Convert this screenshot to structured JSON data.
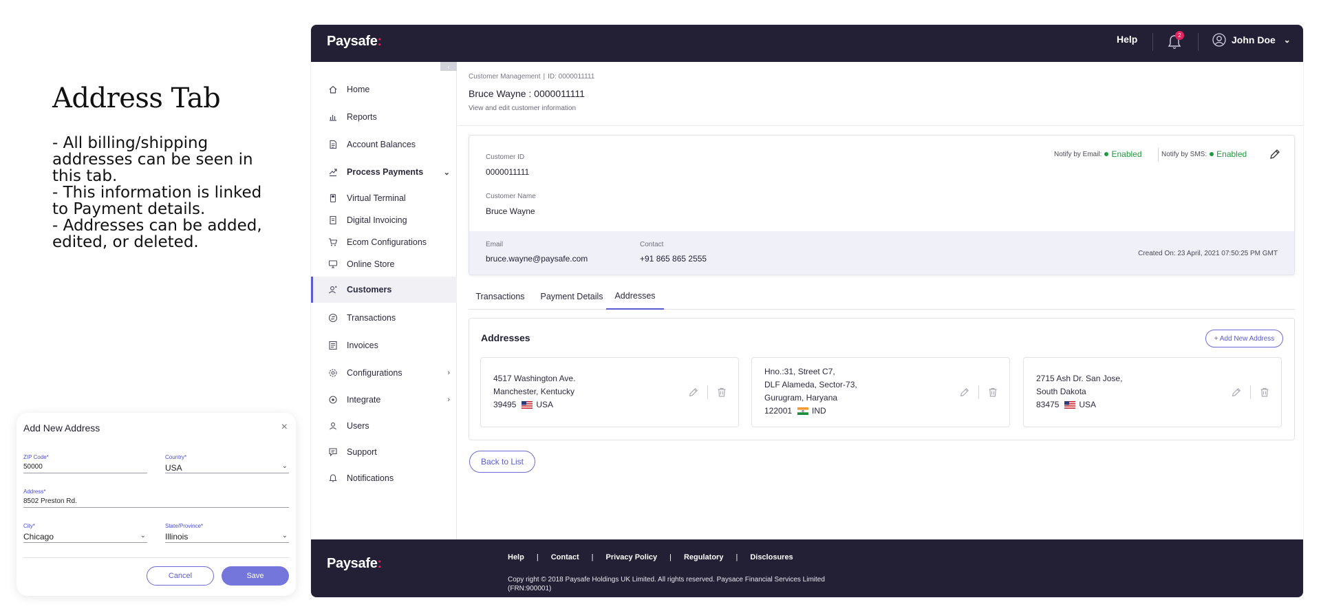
{
  "explainer": {
    "title": "Address Tab",
    "lines": [
      "- All billing/shipping addresses can be seen in this tab.",
      "- This information is linked to Payment details.",
      "- Addresses can be added, edited, or deleted."
    ]
  },
  "modal": {
    "title": "Add New Address",
    "close_icon": "×",
    "zip_label": "ZIP Code*",
    "zip_value": "50000",
    "country_label": "Country*",
    "country_value": "USA",
    "address_label": "Address*",
    "address_value": "8502 Preston Rd.",
    "city_label": "City*",
    "city_value": "Chicago",
    "state_label": "State/Province*",
    "state_value": "Illinois",
    "cancel_label": "Cancel",
    "save_label": "Save"
  },
  "topbar": {
    "brand": "Paysafe",
    "brand_dot": ":",
    "help_label": "Help",
    "notification_count": "2",
    "user_name": "John Doe"
  },
  "sidebar": {
    "items": [
      {
        "label": "Home",
        "icon": "home-icon"
      },
      {
        "label": "Reports",
        "icon": "reports-icon"
      },
      {
        "label": "Account Balances",
        "icon": "document-icon"
      },
      {
        "label": "Process Payments",
        "icon": "payments-icon"
      },
      {
        "label": "Virtual Terminal",
        "icon": "terminal-icon"
      },
      {
        "label": "Digital Invoicing",
        "icon": "invoice-icon"
      },
      {
        "label": "Ecom Configurations",
        "icon": "cart-icon"
      },
      {
        "label": "Online Store",
        "icon": "store-icon"
      },
      {
        "label": "Customers",
        "icon": "customers-icon"
      },
      {
        "label": "Transactions",
        "icon": "transactions-icon"
      },
      {
        "label": "Invoices",
        "icon": "invoices-icon"
      },
      {
        "label": "Configurations",
        "icon": "gear-icon"
      },
      {
        "label": "Integrate",
        "icon": "integrate-icon"
      },
      {
        "label": "Users",
        "icon": "users-icon"
      },
      {
        "label": "Support",
        "icon": "support-icon"
      },
      {
        "label": "Notifications",
        "icon": "bell-icon"
      }
    ]
  },
  "main": {
    "breadcrumb": {
      "section": "Customer Management",
      "separator": "|",
      "id": "ID: 0000011111"
    },
    "title": "Bruce Wayne : 0000011111",
    "subtitle": "View and edit customer information",
    "customer": {
      "id_label": "Customer ID",
      "id_value": "0000011111",
      "name_label": "Customer Name",
      "name_value": "Bruce Wayne",
      "email_label": "Email",
      "email_value": "bruce.wayne@paysafe.com",
      "contact_label": "Contact",
      "contact_value": "+91 865 865 2555",
      "created_on": "Created On: 23 April, 2021 07:50:25 PM GMT",
      "notify_email_label": "Notify by Email:",
      "notify_email_status": "Enabled",
      "notify_sms_label": "Notify by SMS:",
      "notify_sms_status": "Enabled"
    },
    "tabs": [
      "Transactions",
      "Payment Details",
      "Addresses"
    ],
    "active_tab": "Addresses",
    "addresses_title": "Addresses",
    "add_address_label": "+ Add New Address",
    "addresses": [
      {
        "lines": [
          "4517 Washington Ave.",
          "Manchester, Kentucky"
        ],
        "zip": "39495",
        "country": "USA"
      },
      {
        "lines": [
          "Hno.:31, Street C7,",
          "DLF Alameda, Sector-73,",
          "Gurugram, Haryana"
        ],
        "zip": "122001",
        "country": "IND"
      },
      {
        "lines": [
          "2715 Ash Dr. San Jose,",
          "South Dakota"
        ],
        "zip": "83475",
        "country": "USA"
      }
    ],
    "back_label": "Back to List"
  },
  "footer": {
    "brand": "Paysafe",
    "brand_dot": ":",
    "links": [
      "Help",
      "Contact",
      "Privacy Policy",
      "Regulatory",
      "Disclosures"
    ],
    "separator": "|",
    "copyright": "Copy right © 2018 Paysafe Holdings UK Limited. All rights reserved. Paysace Financial Services Limited (FRN:900001)"
  },
  "colors": {
    "header_bg": "#231f35",
    "accent": "#5b5bd0",
    "enabled_green": "#1e9a3c",
    "brand_red": "#e0245e",
    "band_bg": "#f0f0f8"
  }
}
